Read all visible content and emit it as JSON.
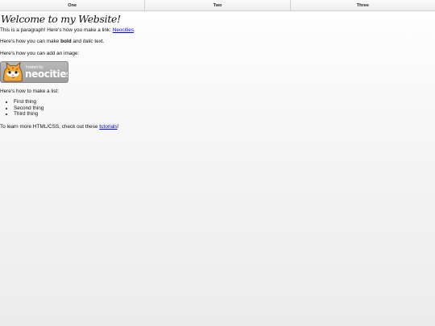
{
  "nav": {
    "items": [
      {
        "label": "One"
      },
      {
        "label": "Two"
      },
      {
        "label": "Three"
      }
    ]
  },
  "main": {
    "title": "Welcome to my Website!",
    "p1": {
      "text": "This is a paragraph! Here's how you make a link: ",
      "link": "Neocities",
      "after": "."
    },
    "p2": {
      "before": "Here's how you can make ",
      "bold": "bold",
      "middle": " and ",
      "italic": "italic",
      "after": " text."
    },
    "p3": "Here's how you can add an image:",
    "badge": {
      "hosted": "hosted by",
      "brand": "neocities",
      "colors": {
        "badge_bg": "#a8a8a8",
        "cat": "#f0a83c"
      }
    },
    "p4": "Here's how to make a list:",
    "list": [
      "First thing",
      "Second thing",
      "Third thing"
    ],
    "p5": {
      "before": "To learn more HTML/CSS, check out these ",
      "link": "tutorials",
      "after": "!"
    }
  },
  "colors": {
    "link": "#0000ee",
    "text": "#111111",
    "nav_border": "#cfcfcf"
  }
}
